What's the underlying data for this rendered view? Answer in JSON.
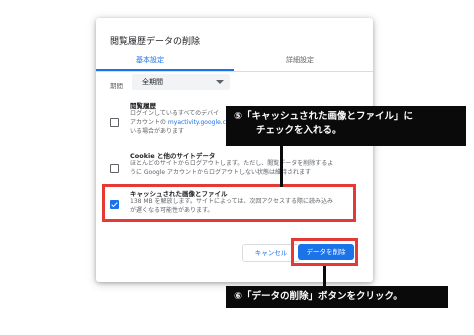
{
  "dialog": {
    "title": "閲覧履歴データの削除",
    "tabs": [
      {
        "label": "基本設定"
      },
      {
        "label": "詳細設定"
      }
    ],
    "period": {
      "label": "期間",
      "value": "全期間"
    },
    "items": [
      {
        "title": "閲覧履歴",
        "desc_lines": [
          "ログインしているすべてのデバイ",
          "アカウントの myactivity.google.c",
          "いる場合があります"
        ],
        "checked": false
      },
      {
        "title": "Cookie と他のサイトデータ",
        "desc_lines": [
          "ほとんどのサイトからログアウトします。ただし、閲覧データを削除するよ",
          "うに Google アカウントからログアウトしない状態は維持されます"
        ],
        "checked": false
      },
      {
        "title": "キャッシュされた画像とファイル",
        "desc_lines": [
          "138 MB を解放します。サイトによっては、次回アクセスする際に読み込み",
          "が遅くなる可能性があります。"
        ],
        "checked": true
      }
    ],
    "buttons": {
      "cancel": "キャンセル",
      "delete": "データを削除"
    }
  },
  "annotations": {
    "callout_top": [
      "⑤「キャッシュされた画像とファイル」に",
      "チェックを入れる。"
    ],
    "callout_bottom": "⑥「データの削除」ボタンをクリック。",
    "frame_color": "#e53935",
    "callout_bg": "#0a0a0a"
  }
}
